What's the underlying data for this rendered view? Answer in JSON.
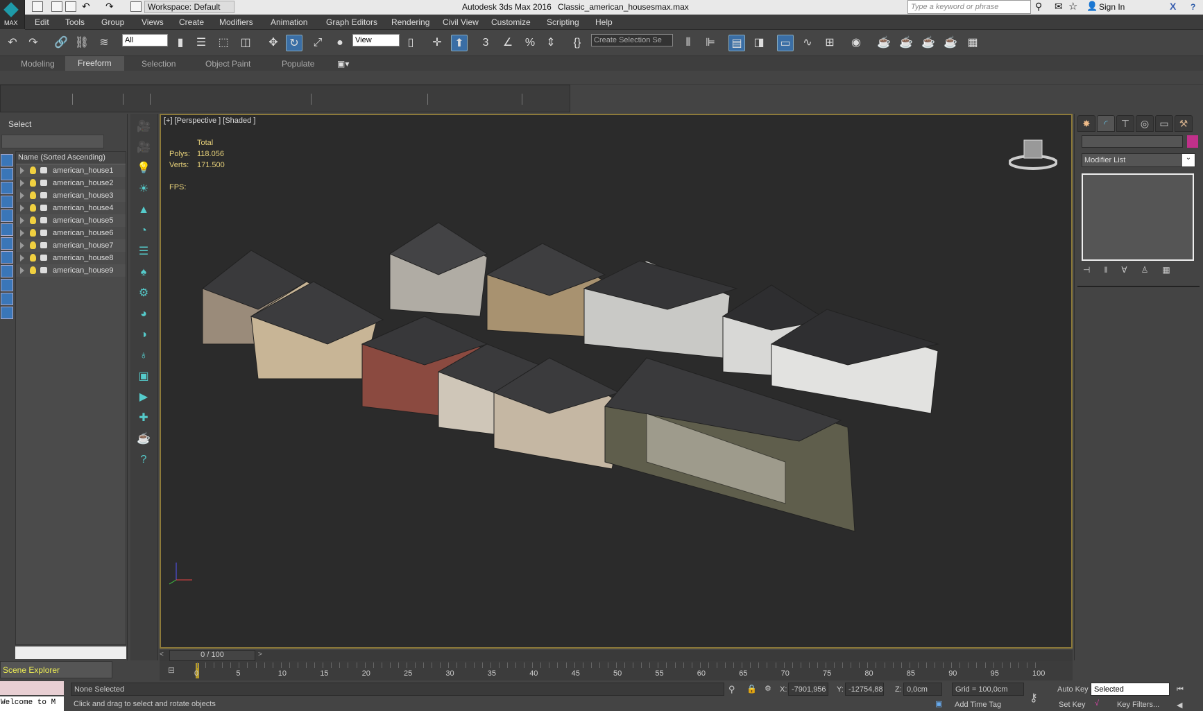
{
  "titlebar": {
    "workspace": "Workspace: Default",
    "app_title": "Autodesk 3ds Max 2016",
    "file_name": "Classic_american_housesmax.max",
    "search_placeholder": "Type a keyword or phrase",
    "sign_in": "Sign In",
    "logo_label": "MAX"
  },
  "menu": [
    "Edit",
    "Tools",
    "Group",
    "Views",
    "Create",
    "Modifiers",
    "Animation",
    "Graph Editors",
    "Rendering",
    "Civil View",
    "Customize",
    "Scripting",
    "Help"
  ],
  "toolbar": {
    "selection_filter": "All",
    "reference_coord": "View",
    "named_selection": "Create Selection Se"
  },
  "ribbon_tabs": [
    "Modeling",
    "Freeform",
    "Selection",
    "Object Paint",
    "Populate"
  ],
  "ribbon_active": "Freeform",
  "scene_explorer": {
    "title": "Select",
    "column_header": "Name (Sorted Ascending)",
    "items": [
      "american_house1",
      "american_house2",
      "american_house3",
      "american_house4",
      "american_house5",
      "american_house6",
      "american_house7",
      "american_house8",
      "american_house9"
    ],
    "footer": "Scene Explorer"
  },
  "viewport": {
    "label": "[+] [Perspective ] [Shaded ]",
    "stats": {
      "total_label": "Total",
      "polys_label": "Polys:",
      "polys": "118.056",
      "verts_label": "Verts:",
      "verts": "171.500",
      "fps_label": "FPS:"
    }
  },
  "command_panel": {
    "modifier_list": "Modifier List",
    "accent_color": "#c0308a"
  },
  "timeline": {
    "frame_display": "0 / 100",
    "prev": "<",
    "next": ">",
    "ticks": [
      0,
      5,
      10,
      15,
      20,
      25,
      30,
      35,
      40,
      45,
      50,
      55,
      60,
      65,
      70,
      75,
      80,
      85,
      90,
      95,
      100
    ]
  },
  "status": {
    "maxscript": "Welcome to M",
    "selection": "None Selected",
    "prompt": "Click and drag to select and rotate objects",
    "x_label": "X:",
    "x": "-7901,956",
    "y_label": "Y:",
    "y": "-12754,88",
    "z_label": "Z:",
    "z": "0,0cm",
    "grid": "Grid = 100,0cm",
    "add_time_tag": "Add Time Tag",
    "auto_key": "Auto Key",
    "set_key": "Set Key",
    "key_mode": "Selected",
    "key_filters": "Key Filters..."
  }
}
